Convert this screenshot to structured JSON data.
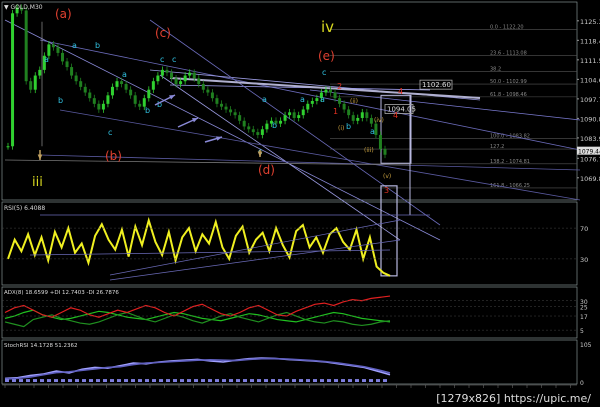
{
  "chart_data": [
    {
      "type": "line",
      "panel": "price",
      "title": "GOLD,M30",
      "ylim": [
        1062,
        1132
      ],
      "y_ticks": [
        "1125.35",
        "1118.45",
        "1111.55",
        "1104.65",
        "1097.75",
        "1090.85",
        "1083.95",
        "1076.75",
        "1069.85"
      ],
      "price_box_label": "1102.60",
      "price_marker_label": "1094.05",
      "current_price_label": "1079.44",
      "fib_levels": [
        {
          "label": "0.0 - 1122.20",
          "value": 1122.2
        },
        {
          "label": "23.6 - 1113.08",
          "value": 1113.08
        },
        {
          "label": "38.2",
          "value": 1107.5
        },
        {
          "label": "50.0 - 1102.99",
          "value": 1102.99
        },
        {
          "label": "61.8 - 1098.46",
          "value": 1098.46
        },
        {
          "label": "100.0 - 1083.82",
          "value": 1083.82
        },
        {
          "label": "127.2",
          "value": 1080.0
        },
        {
          "label": "138.2 - 1074.81",
          "value": 1074.81
        },
        {
          "label": "161.8 - 1066.25",
          "value": 1066.25
        }
      ],
      "close_series": [
        1081,
        1128,
        1130,
        1129,
        1104,
        1101,
        1106,
        1108,
        1113,
        1117,
        1116,
        1114,
        1111,
        1109,
        1106,
        1104,
        1102,
        1100,
        1098,
        1096,
        1094,
        1096,
        1099,
        1102,
        1104,
        1103,
        1101,
        1099,
        1096,
        1095,
        1098,
        1101,
        1104,
        1106,
        1108,
        1107,
        1105,
        1103,
        1104,
        1106,
        1107,
        1105,
        1103,
        1101,
        1100,
        1098,
        1096,
        1095,
        1094,
        1093,
        1092,
        1090,
        1088,
        1087,
        1086,
        1085,
        1087,
        1089,
        1090,
        1089,
        1090,
        1092,
        1093,
        1091,
        1092,
        1094,
        1096,
        1097,
        1098,
        1100,
        1101,
        1100,
        1098,
        1096,
        1094,
        1092,
        1090,
        1091,
        1093,
        1091,
        1089,
        1085,
        1080,
        1078
      ],
      "wave_labels": [
        {
          "text": "(a)",
          "color": "#e04030"
        },
        {
          "text": "(b)",
          "color": "#e04030"
        },
        {
          "text": "(c)",
          "color": "#e04030"
        },
        {
          "text": "(d)",
          "color": "#e04030"
        },
        {
          "text": "(e)",
          "color": "#e04030"
        },
        {
          "text": "iv",
          "color": "#d8d820"
        },
        {
          "text": "iii",
          "color": "#d8d820"
        },
        {
          "text": "a",
          "color": "#30c0e0"
        },
        {
          "text": "b",
          "color": "#30c0e0"
        },
        {
          "text": "c",
          "color": "#30c0e0"
        },
        {
          "text": "(i)",
          "color": "#c8a040"
        },
        {
          "text": "(ii)",
          "color": "#c8a040"
        },
        {
          "text": "(iii)",
          "color": "#c8a040"
        },
        {
          "text": "(iv)",
          "color": "#c8a040"
        },
        {
          "text": "(v)",
          "color": "#c8a040"
        },
        {
          "text": "1",
          "color": "#e03020"
        },
        {
          "text": "2",
          "color": "#e03020"
        },
        {
          "text": "3",
          "color": "#e03020"
        },
        {
          "text": "4",
          "color": "#e03020"
        }
      ]
    },
    {
      "type": "line",
      "panel": "rsi",
      "title": "RSI(5) 6.4088",
      "ylim": [
        0,
        100
      ],
      "series": [
        {
          "values": [
            30,
            55,
            40,
            62,
            35,
            58,
            28,
            65,
            45,
            70,
            38,
            50,
            25,
            60,
            75,
            55,
            42,
            68,
            33,
            72,
            48,
            80,
            52,
            35,
            65,
            28,
            58,
            70,
            40,
            62,
            50,
            78,
            45,
            30,
            60,
            72,
            38,
            55,
            64,
            40,
            70,
            48,
            32,
            66,
            74,
            45,
            58,
            38,
            62,
            70,
            52,
            42,
            68,
            30,
            58,
            20,
            12,
            8
          ]
        }
      ],
      "y_ticks": [
        "70",
        "30"
      ]
    },
    {
      "type": "line",
      "panel": "adx",
      "title": "ADX(8) 18.6599 +DI 12.7403 -DI 26.7876",
      "ylim": [
        0,
        40
      ],
      "y_ticks": [
        "30",
        "25",
        "17",
        "5"
      ],
      "series": [
        {
          "name": "ADX",
          "values": [
            15,
            17,
            20,
            22,
            18,
            16,
            14,
            15,
            17,
            19,
            21,
            20,
            18,
            16,
            15,
            14,
            16,
            18,
            20,
            19,
            17,
            15,
            14,
            13,
            15,
            17,
            19,
            18,
            16,
            14,
            13,
            12,
            14,
            16,
            18,
            20,
            19,
            17,
            15,
            14,
            13,
            12
          ]
        },
        {
          "name": "+DI",
          "values": [
            12,
            10,
            8,
            14,
            16,
            18,
            15,
            13,
            11,
            10,
            12,
            15,
            18,
            20,
            17,
            14,
            12,
            15,
            18,
            16,
            13,
            11,
            14,
            17,
            19,
            16,
            14,
            12,
            15,
            18,
            20,
            17,
            14,
            12,
            11,
            13,
            12,
            10,
            9,
            10,
            12,
            13
          ]
        },
        {
          "name": "-DI",
          "values": [
            20,
            24,
            26,
            22,
            18,
            16,
            20,
            24,
            22,
            18,
            16,
            19,
            22,
            20,
            23,
            26,
            24,
            20,
            17,
            21,
            25,
            27,
            23,
            19,
            17,
            20,
            24,
            26,
            22,
            18,
            17,
            21,
            24,
            27,
            28,
            26,
            29,
            31,
            30,
            32,
            33,
            34
          ]
        }
      ]
    },
    {
      "type": "line",
      "panel": "stoch",
      "title": "StochRSI 14.1728 51.2362",
      "ylim": [
        0,
        110
      ],
      "y_ticks": [
        "105",
        "0"
      ],
      "series": [
        {
          "values": [
            10,
            12,
            18,
            22,
            30,
            25,
            35,
            40,
            38,
            45,
            52,
            50,
            55,
            58,
            60,
            62,
            58,
            55,
            60,
            64,
            66,
            65,
            62,
            60,
            58,
            55,
            50,
            45,
            40,
            30,
            20
          ]
        },
        {
          "values": [
            8,
            10,
            14,
            20,
            26,
            28,
            32,
            36,
            40,
            42,
            48,
            52,
            54,
            56,
            58,
            60,
            61,
            60,
            59,
            62,
            64,
            64,
            63,
            61,
            59,
            56,
            52,
            47,
            42,
            34,
            25
          ]
        }
      ]
    }
  ],
  "watermark": "[1279x826] https://upic.me/"
}
